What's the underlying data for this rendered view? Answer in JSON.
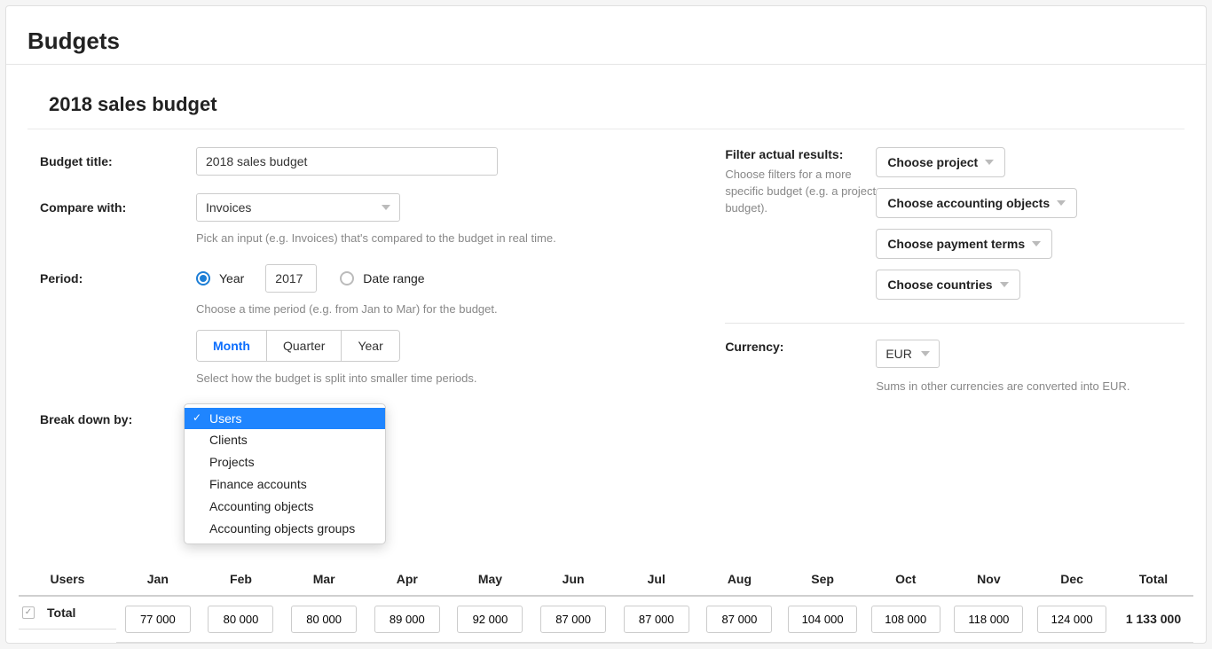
{
  "page_title": "Budgets",
  "subtitle": "2018 sales budget",
  "form": {
    "budget_title_label": "Budget title:",
    "budget_title_value": "2018 sales budget",
    "compare_with_label": "Compare with:",
    "compare_with_value": "Invoices",
    "compare_help": "Pick an input (e.g. Invoices) that's compared to the budget in real time.",
    "period_label": "Period:",
    "period_year_label": "Year",
    "period_year_value": "2017",
    "period_range_label": "Date range",
    "period_help": "Choose a time period (e.g. from Jan to Mar) for the budget.",
    "seg_month": "Month",
    "seg_quarter": "Quarter",
    "seg_year": "Year",
    "seg_help": "Select how the budget is split into smaller time periods.",
    "breakdown_label": "Break down by:"
  },
  "dropdown": {
    "items": [
      "Users",
      "Clients",
      "Projects",
      "Finance accounts",
      "Accounting objects",
      "Accounting objects groups"
    ],
    "selected_index": 0
  },
  "filters": {
    "label": "Filter actual results:",
    "help": "Choose filters for a more specific budget (e.g. a project budget).",
    "buttons": [
      "Choose project",
      "Choose accounting objects",
      "Choose payment terms",
      "Choose countries"
    ]
  },
  "currency": {
    "label": "Currency:",
    "value": "EUR",
    "help": "Sums in other currencies are converted into EUR."
  },
  "table": {
    "headers": [
      "Users",
      "Jan",
      "Feb",
      "Mar",
      "Apr",
      "May",
      "Jun",
      "Jul",
      "Aug",
      "Sep",
      "Oct",
      "Nov",
      "Dec",
      "Total"
    ],
    "row_label": "Total",
    "values": [
      "77 000",
      "80 000",
      "80 000",
      "89 000",
      "92 000",
      "87 000",
      "87 000",
      "87 000",
      "104 000",
      "108 000",
      "118 000",
      "124 000"
    ],
    "total": "1 133 000"
  }
}
